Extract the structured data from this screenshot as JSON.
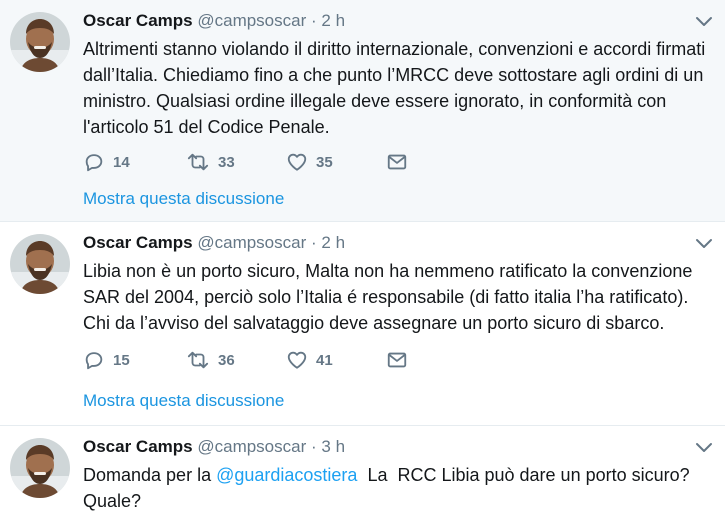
{
  "tweets": [
    {
      "author_name": "Oscar Camps",
      "author_handle": "@campsoscar",
      "separator": "·",
      "time": "2 h",
      "text": "Altrimenti stanno violando il diritto internazionale, convenzioni e accordi firmati dall’Italia. Chiediamo fino a che punto l’MRCC deve sottostare agli ordini di un ministro. Qualsiasi ordine illegale deve essere ignorato, in conformità con l'articolo 51 del Codice Penale.",
      "replies": "14",
      "retweets": "33",
      "likes": "35",
      "show_thread": "Mostra questa discussione"
    },
    {
      "author_name": "Oscar Camps",
      "author_handle": "@campsoscar",
      "separator": "·",
      "time": "2 h",
      "text": "Libia non è un porto sicuro, Malta non ha nemmeno ratificato la convenzione SAR del 2004, perciò solo l’Italia é responsabile (di fatto italia l’ha ratificato). Chi da l’avviso del salvataggio deve assegnare un porto sicuro di sbarco.",
      "replies": "15",
      "retweets": "36",
      "likes": "41",
      "show_thread": "Mostra questa discussione"
    },
    {
      "author_name": "Oscar Camps",
      "author_handle": "@campsoscar",
      "separator": "·",
      "time": "3 h",
      "text_before": "Domanda per la ",
      "mention": "@guardiacostiera",
      "text_after": "  La  RCC Libia può dare un porto sicuro? Quale?"
    }
  ],
  "icons": {
    "reply": "reply-icon",
    "retweet": "retweet-icon",
    "like": "heart-icon",
    "dm": "envelope-icon",
    "menu": "chevron-down-icon"
  },
  "colors": {
    "link": "#1da1f2",
    "muted": "#657786",
    "highlight_bg": "#f5f8fa"
  }
}
